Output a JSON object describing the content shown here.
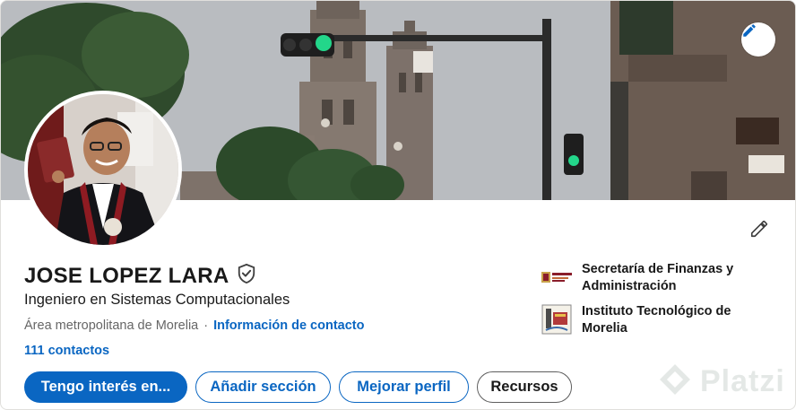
{
  "profile": {
    "name": "JOSE LOPEZ LARA",
    "headline": "Ingeniero en Sistemas Computacionales",
    "location": "Área metropolitana de Morelia",
    "separator": "·",
    "contact_info_link": "Información de contacto",
    "connections": "111 contactos",
    "verified_icon": "shield-check-icon"
  },
  "organizations": [
    {
      "name": "Secretaría de Finanzas y Administración",
      "logo": "government-logo"
    },
    {
      "name": "Instituto Tecnológico de Morelia",
      "logo": "institute-seal-logo"
    }
  ],
  "actions": {
    "open_to": "Tengo interés en...",
    "add_section": "Añadir sección",
    "improve_profile": "Mejorar perfil",
    "resources": "Recursos"
  },
  "icons": {
    "edit_cover": "pencil-icon",
    "edit_intro": "pencil-icon"
  },
  "watermark": {
    "text": "Platzi"
  },
  "colors": {
    "accent": "#0a66c2",
    "text": "#191919",
    "muted": "#666666"
  }
}
